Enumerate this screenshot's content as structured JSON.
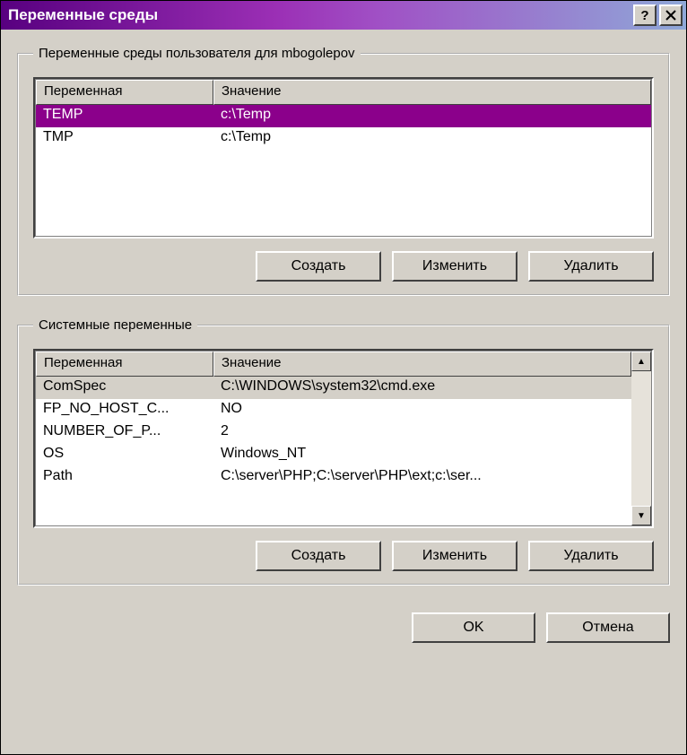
{
  "title": "Переменные среды",
  "sections": {
    "user": {
      "legend": "Переменные среды пользователя для mbogolepov",
      "headers": {
        "var": "Переменная",
        "val": "Значение"
      },
      "rows": [
        {
          "var": "TEMP",
          "val": "c:\\Temp",
          "selected": true
        },
        {
          "var": "TMP",
          "val": "c:\\Temp",
          "selected": false
        }
      ],
      "buttons": {
        "create": "Создать",
        "edit": "Изменить",
        "delete": "Удалить"
      }
    },
    "system": {
      "legend": "Системные переменные",
      "headers": {
        "var": "Переменная",
        "val": "Значение"
      },
      "rows": [
        {
          "var": "ComSpec",
          "val": "C:\\WINDOWS\\system32\\cmd.exe",
          "selected": true
        },
        {
          "var": "FP_NO_HOST_C...",
          "val": "NO",
          "selected": false
        },
        {
          "var": "NUMBER_OF_P...",
          "val": "2",
          "selected": false
        },
        {
          "var": "OS",
          "val": "Windows_NT",
          "selected": false
        },
        {
          "var": "Path",
          "val": "C:\\server\\PHP;C:\\server\\PHP\\ext;c:\\ser...",
          "selected": false
        }
      ],
      "buttons": {
        "create": "Создать",
        "edit": "Изменить",
        "delete": "Удалить"
      }
    }
  },
  "footer": {
    "ok": "OK",
    "cancel": "Отмена"
  }
}
